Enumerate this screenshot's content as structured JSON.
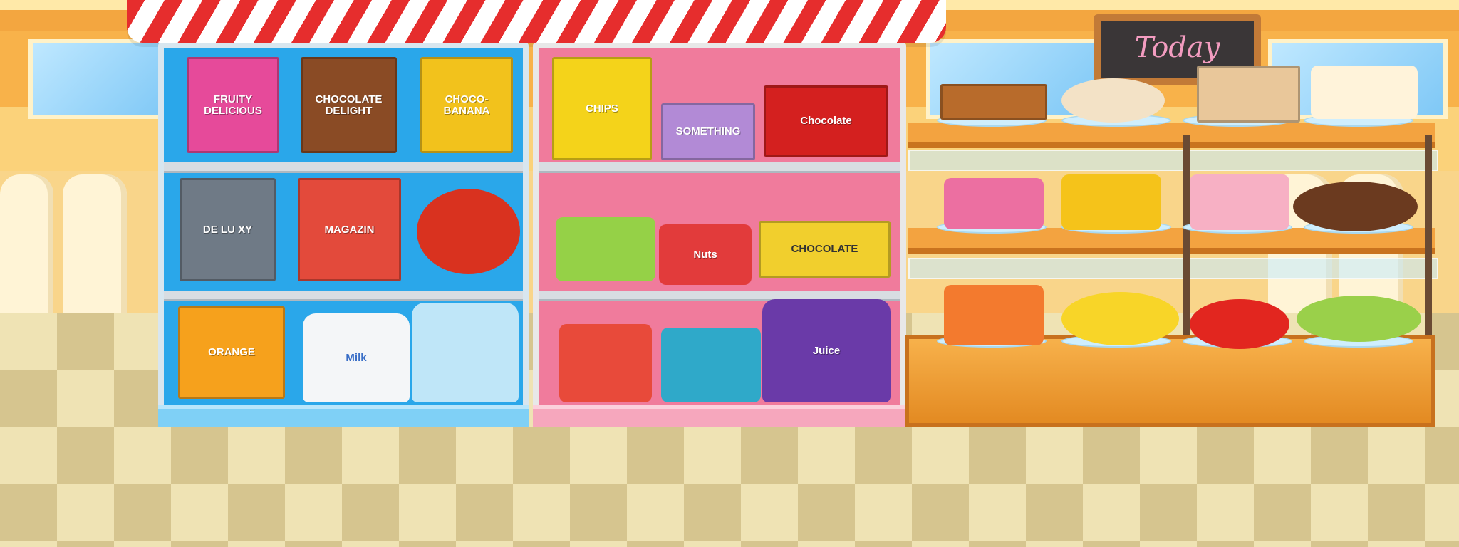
{
  "colors": {
    "awning_red": "#e62d2d",
    "shelf_blue": "#2aa7ea",
    "shelf_pink": "#f07b9c",
    "wood": "#f3a340"
  },
  "sign": {
    "text": "Today"
  },
  "shelf_blue": {
    "row1": [
      {
        "icon": "cereal-box-icon",
        "label": "FRUITY DELICIOUS",
        "color": "#e64a9a"
      },
      {
        "icon": "cereal-box-icon",
        "label": "CHOCOLATE DELIGHT",
        "color": "#8a4b25"
      },
      {
        "icon": "cereal-box-icon",
        "label": "CHOCO-BANANA",
        "color": "#f2c21c"
      }
    ],
    "row2": [
      {
        "icon": "magazine-icon",
        "label": "DE LU XY",
        "color": "#6f7a86"
      },
      {
        "icon": "magazine-icon",
        "label": "MAGAZIN",
        "color": "#e34a3b"
      },
      {
        "icon": "candy-icon",
        "label": "",
        "color": "#d9321f"
      }
    ],
    "row3": [
      {
        "icon": "juice-carton-icon",
        "label": "ORANGE",
        "color": "#f6a11c"
      },
      {
        "icon": "milk-bottle-icon",
        "label": "Milk",
        "color": "#f4f6f8"
      },
      {
        "icon": "water-bottle-icon",
        "label": "",
        "color": "#bfe6f8"
      }
    ]
  },
  "shelf_pink": {
    "row1": [
      {
        "icon": "chips-bag-icon",
        "label": "CHIPS",
        "color": "#f4d31a"
      },
      {
        "icon": "chocolate-bar-icon",
        "label": "SOMETHING",
        "color": "#b28ad6"
      },
      {
        "icon": "chocolate-bar-icon",
        "label": "Chocolate",
        "color": "#d4201f"
      }
    ],
    "row2": [
      {
        "icon": "jam-jar-icon",
        "label": "",
        "color": "#95d147"
      },
      {
        "icon": "nuts-can-icon",
        "label": "Nuts",
        "color": "#e23b3b"
      },
      {
        "icon": "candy-box-icon",
        "label": "CHOCOLATE",
        "color": "#f1cf2d"
      }
    ],
    "row3": [
      {
        "icon": "can-icon",
        "label": "",
        "color": "#e84a3a"
      },
      {
        "icon": "yogurt-cup-icon",
        "label": "",
        "color": "#2fa9c9"
      },
      {
        "icon": "juice-bottle-icon",
        "label": "Juice",
        "color": "#6a3aa8"
      }
    ]
  },
  "bakery": {
    "row1": [
      {
        "icon": "waffle-icon",
        "label": "",
        "color": "#b86b2b"
      },
      {
        "icon": "donut-icon",
        "label": "",
        "color": "#f3e2c6"
      },
      {
        "icon": "bread-icon",
        "label": "",
        "color": "#e9c79a"
      },
      {
        "icon": "cupcake-icon",
        "label": "",
        "color": "#fff3da"
      }
    ],
    "row2": [
      {
        "icon": "cupcake-icon",
        "label": "",
        "color": "#ec6fa1"
      },
      {
        "icon": "cupcake-icon",
        "label": "",
        "color": "#f5c31a"
      },
      {
        "icon": "cupcake-icon",
        "label": "",
        "color": "#f7b0c4"
      },
      {
        "icon": "donut-icon",
        "label": "",
        "color": "#6b3a1f"
      }
    ],
    "row3": [
      {
        "icon": "jam-jar-icon",
        "label": "",
        "color": "#f37a2e"
      },
      {
        "icon": "banana-icon",
        "label": "",
        "color": "#f8d528"
      },
      {
        "icon": "tomato-icon",
        "label": "",
        "color": "#e2261f"
      },
      {
        "icon": "corn-icon",
        "label": "",
        "color": "#9ad04a"
      }
    ]
  }
}
